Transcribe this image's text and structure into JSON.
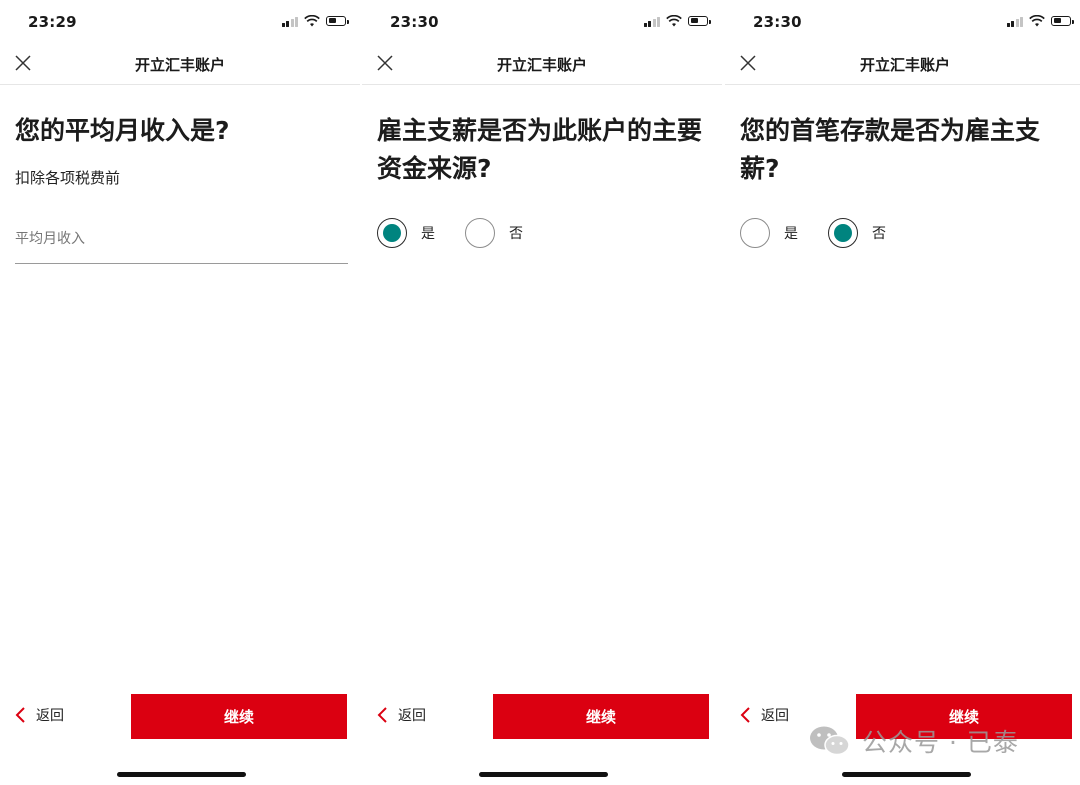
{
  "colors": {
    "brand_red": "#db0011",
    "radio_selected": "#00847f",
    "text_primary": "#1c1c1c"
  },
  "screens": [
    {
      "status": {
        "time": "23:29"
      },
      "nav": {
        "title": "开立汇丰账户",
        "close_icon": "close-icon"
      },
      "question": "您的平均月收入是?",
      "subtitle": "扣除各项税费前",
      "income_input": {
        "placeholder": "平均月收入",
        "value": ""
      },
      "footer": {
        "back_label": "返回",
        "continue_label": "继续"
      }
    },
    {
      "status": {
        "time": "23:30"
      },
      "nav": {
        "title": "开立汇丰账户",
        "close_icon": "close-icon"
      },
      "question": "雇主支薪是否为此账户的主要资金来源?",
      "options": [
        {
          "label": "是",
          "selected": true
        },
        {
          "label": "否",
          "selected": false
        }
      ],
      "footer": {
        "back_label": "返回",
        "continue_label": "继续"
      }
    },
    {
      "status": {
        "time": "23:30"
      },
      "nav": {
        "title": "开立汇丰账户",
        "close_icon": "close-icon"
      },
      "question": "您的首笔存款是否为雇主支薪?",
      "options": [
        {
          "label": "是",
          "selected": false
        },
        {
          "label": "否",
          "selected": true
        }
      ],
      "footer": {
        "back_label": "返回",
        "continue_label": "继续"
      }
    }
  ],
  "watermark": {
    "text": "公众号 · 已泰",
    "icon": "wechat-icon"
  }
}
